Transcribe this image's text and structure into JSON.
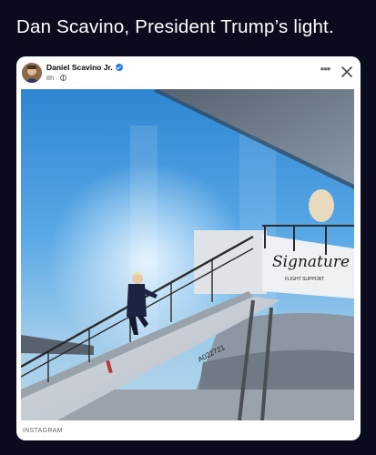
{
  "post": {
    "caption": "Dan Scavino, President Trump’s light."
  },
  "card": {
    "author": "Daniel Scavino Jr.",
    "timestamp": "8h ·",
    "more_icon": "more-horizontal-icon",
    "close_icon": "close-icon",
    "verified_icon": "verified-badge-icon",
    "privacy_icon": "globe-icon",
    "source": "INSTAGRAM"
  },
  "photo": {
    "stair_brand": "Signature",
    "stair_brand_sub": "FLIGHT SUPPORT",
    "stair_id": "A022721"
  },
  "colors": {
    "background": "#0b0b1e",
    "card": "#ffffff",
    "verified": "#1877f2",
    "sky": "#3a8fd6"
  }
}
